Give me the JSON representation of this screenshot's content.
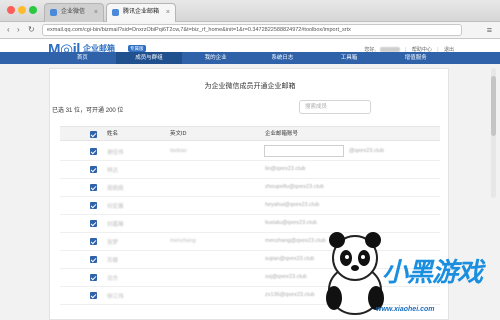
{
  "browser": {
    "tabs": [
      {
        "label": "企业微信",
        "active": false
      },
      {
        "label": "腾讯企业邮箱",
        "active": true
      }
    ],
    "url": "exmail.qq.com/cgi-bin/bizmail?sid=DnxrzObiPqi6T2cw,7&t=biz_rf_home&init=1&r=0.3472822588824972#toolbox/import_srtx"
  },
  "header": {
    "logo_m": "M◎il",
    "logo_name": "企业邮箱",
    "logo_sub": "exmail.qq.com",
    "logo_badge": "专属版",
    "user_greeting": "您好,",
    "help_link": "帮助中心",
    "logout_link": "退出"
  },
  "nav": {
    "items": [
      {
        "label": "首页",
        "active": false
      },
      {
        "label": "成员与群组",
        "active": true
      },
      {
        "label": "我的企业",
        "active": false
      },
      {
        "label": "系统日志",
        "active": false
      },
      {
        "label": "工具箱",
        "active": false
      },
      {
        "label": "增值服务",
        "active": false
      }
    ]
  },
  "panel": {
    "title": "为企业微信成员开通企业邮箱",
    "selected_prefix": "已选",
    "selected_count": "31",
    "selected_mid": "位，可开通",
    "available_count": "200",
    "selected_suffix": "位",
    "search_placeholder": "搜索成员"
  },
  "table": {
    "headers": {
      "name": "姓名",
      "english_id": "英文ID",
      "email": "企业邮箱账号"
    },
    "rows": [
      {
        "name": "谢佳伟",
        "english_id": "taobao",
        "email": "",
        "suffix": "@qxex23.club",
        "editable": true
      },
      {
        "name": "林达",
        "english_id": "",
        "email": "lin@qxex23.club"
      },
      {
        "name": "周佩佩",
        "english_id": "",
        "email": "zhoupeifu@qxex23.club"
      },
      {
        "name": "何宏雅",
        "english_id": "",
        "email": "heyahui@qxex23.club"
      },
      {
        "name": "刘嘉琳",
        "english_id": "",
        "email": "liuxialu@qxex23.club"
      },
      {
        "name": "张梦",
        "english_id": "menzhang",
        "email": "menzhang@qxex23.club"
      },
      {
        "name": "苏健",
        "english_id": "",
        "email": "sujian@qxex23.club"
      },
      {
        "name": "沈杰",
        "english_id": "",
        "email": "sxj@qxex23.club"
      },
      {
        "name": "徐江玮",
        "english_id": "",
        "email": "zx136@qxex23.club"
      }
    ]
  },
  "watermark": {
    "brand": "小黑游戏",
    "url": "www.xiaohei.com"
  },
  "colors": {
    "nav_bg": "#2f62a9",
    "brand_blue": "#2f6fc2",
    "checkbox": "#2f62a9"
  }
}
